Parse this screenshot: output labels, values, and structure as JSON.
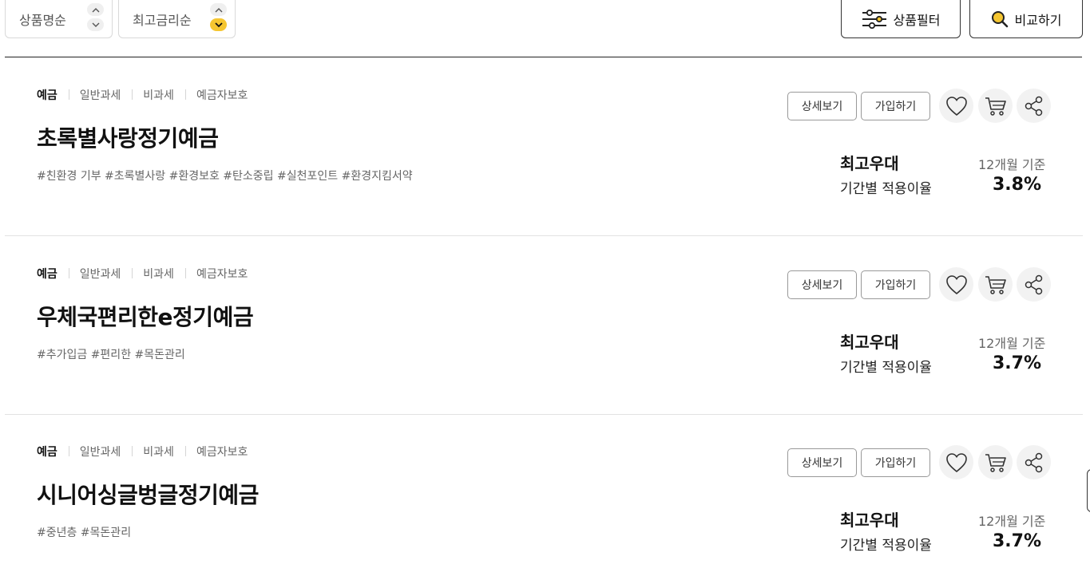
{
  "sort": {
    "by_name": "상품명순",
    "by_rate": "최고금리순"
  },
  "toolbar": {
    "filter_label": "상품필터",
    "compare_label": "비교하기"
  },
  "products": [
    {
      "tags": [
        "예금",
        "일반과세",
        "비과세",
        "예금자보호"
      ],
      "name": "초록별사랑정기예금",
      "hashtags": "#친환경 기부 #초록별사랑 #환경보호 #탄소중립 #실천포인트 #환경지킴서약",
      "detail_label": "상세보기",
      "join_label": "가입하기",
      "rate_title": "최고우대",
      "rate_sub": "기간별 적용이율",
      "rate_basis": "12개월 기준",
      "rate_value": "3.8%"
    },
    {
      "tags": [
        "예금",
        "일반과세",
        "비과세",
        "예금자보호"
      ],
      "name": "우체국편리한e정기예금",
      "hashtags": "#추가입금 #편리한 #목돈관리",
      "detail_label": "상세보기",
      "join_label": "가입하기",
      "rate_title": "최고우대",
      "rate_sub": "기간별 적용이율",
      "rate_basis": "12개월 기준",
      "rate_value": "3.7%"
    },
    {
      "tags": [
        "예금",
        "일반과세",
        "비과세",
        "예금자보호"
      ],
      "name": "시니어싱글벙글정기예금",
      "hashtags": "#중년층 #목돈관리",
      "detail_label": "상세보기",
      "join_label": "가입하기",
      "rate_title": "최고우대",
      "rate_sub": "기간별 적용이율",
      "rate_basis": "12개월 기준",
      "rate_value": "3.7%"
    }
  ],
  "colors": {
    "accent": "#f5c631",
    "border": "#d9d9d9",
    "text": "#111111",
    "muted": "#666666"
  },
  "icons": {
    "filter": "sliders-icon",
    "compare": "search-icon",
    "wish": "heart-icon",
    "cart": "cart-icon",
    "share": "share-icon"
  }
}
